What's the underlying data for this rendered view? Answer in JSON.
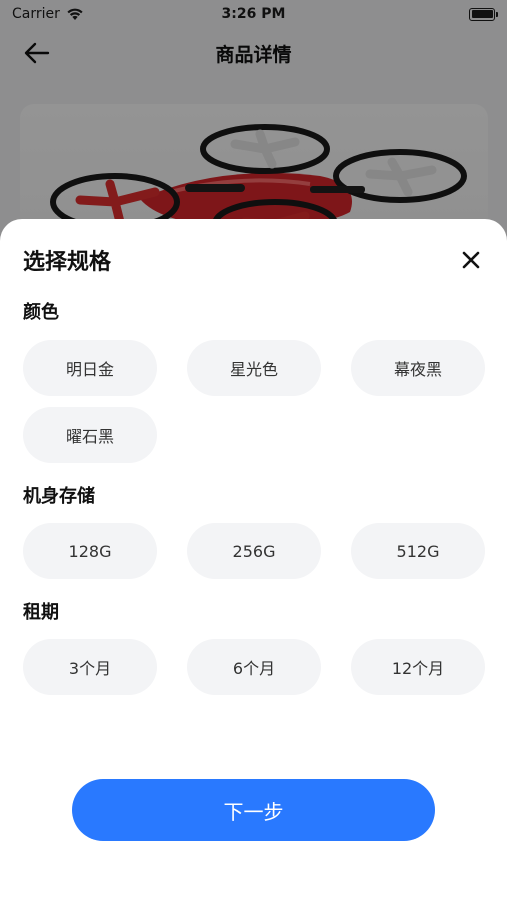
{
  "status_bar": {
    "carrier": "Carrier",
    "time": "3:26 PM",
    "icons": [
      "wifi-icon",
      "battery-icon"
    ]
  },
  "nav": {
    "title": "商品详情",
    "back_icon": "arrow-left-icon"
  },
  "sheet": {
    "title": "选择规格",
    "close_icon": "close-icon",
    "color": {
      "label": "颜色",
      "options": [
        "明日金",
        "星光色",
        "幕夜黑",
        "曜石黑"
      ]
    },
    "storage": {
      "label": "机身存储",
      "options": [
        "128G",
        "256G",
        "512G"
      ]
    },
    "term": {
      "label": "租期",
      "options": [
        "3个月",
        "6个月",
        "12个月"
      ]
    },
    "next_label": "下一步"
  },
  "colors": {
    "accent": "#2979ff",
    "option_bg": "#f3f4f6",
    "overlay": "rgba(0,0,0,0.42)"
  }
}
